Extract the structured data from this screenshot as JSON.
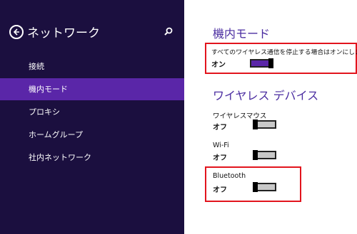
{
  "sidebar": {
    "title": "ネットワーク",
    "items": [
      {
        "label": "接続"
      },
      {
        "label": "機内モード",
        "selected": true
      },
      {
        "label": "プロキシ"
      },
      {
        "label": "ホームグループ"
      },
      {
        "label": "社内ネットワーク"
      }
    ]
  },
  "airplane": {
    "title": "機内モード",
    "description": "すべてのワイヤレス通信を停止する場合はオンにします",
    "state": "オン",
    "on": true
  },
  "wireless": {
    "title": "ワイヤレス デバイス",
    "devices": [
      {
        "name": "ワイヤレスマウス",
        "state": "オフ",
        "on": false
      },
      {
        "name": "Wi-Fi",
        "state": "オフ",
        "on": false
      },
      {
        "name": "Bluetooth",
        "state": "オフ",
        "on": false
      }
    ]
  },
  "colors": {
    "sidebar_bg": "#1b0f3f",
    "accent": "#5a26a8",
    "title": "#4a2ca0",
    "highlight": "#e2141d"
  },
  "icons": {
    "back": "back-arrow-icon",
    "search": "search-icon"
  }
}
